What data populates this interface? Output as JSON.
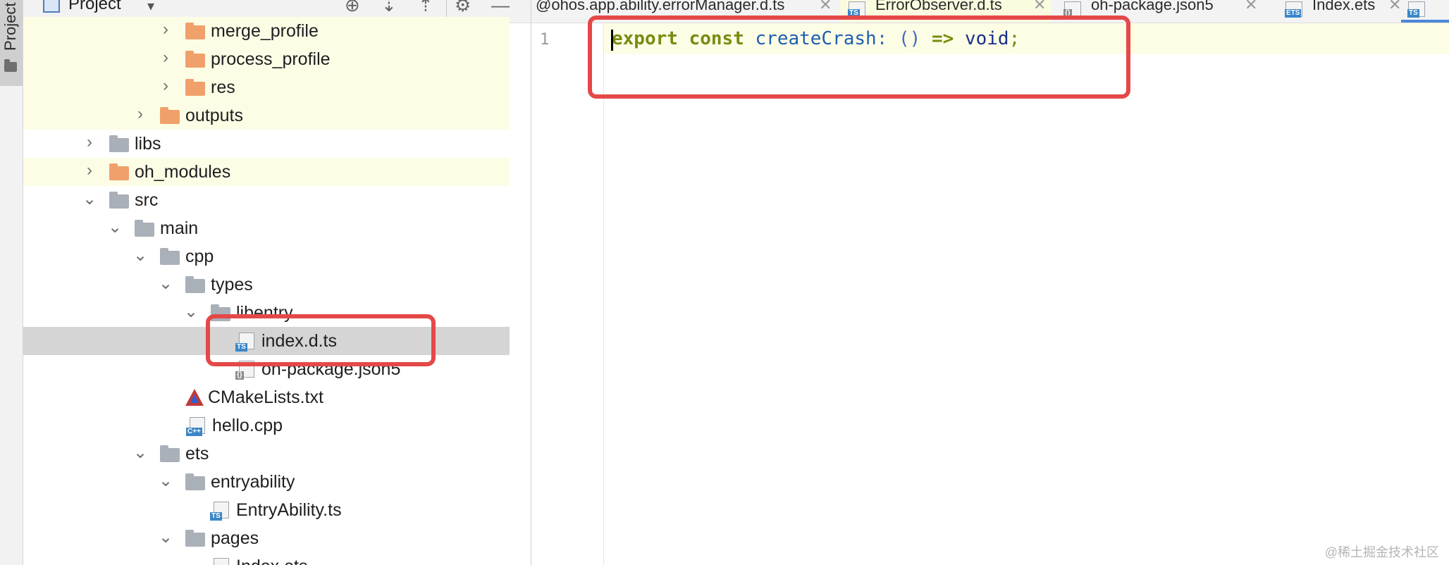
{
  "sidebar_strip": {
    "label": "Project"
  },
  "panel_header": {
    "title": "Project"
  },
  "tree": [
    {
      "label": "merge_profile",
      "kind": "folder-orange",
      "state": "collapsed"
    },
    {
      "label": "process_profile",
      "kind": "folder-orange",
      "state": "collapsed"
    },
    {
      "label": "res",
      "kind": "folder-orange",
      "state": "collapsed"
    },
    {
      "label": "outputs",
      "kind": "folder-orange",
      "state": "collapsed"
    },
    {
      "label": "libs",
      "kind": "folder-gray",
      "state": "collapsed"
    },
    {
      "label": "oh_modules",
      "kind": "folder-orange",
      "state": "collapsed"
    },
    {
      "label": "src",
      "kind": "folder-gray",
      "state": "expanded"
    },
    {
      "label": "main",
      "kind": "folder-gray",
      "state": "expanded"
    },
    {
      "label": "cpp",
      "kind": "folder-gray",
      "state": "expanded"
    },
    {
      "label": "types",
      "kind": "folder-gray",
      "state": "expanded"
    },
    {
      "label": "libentry",
      "kind": "folder-gray",
      "state": "expanded"
    },
    {
      "label": "index.d.ts",
      "kind": "file-ts",
      "state": "selected"
    },
    {
      "label": "oh-package.json5",
      "kind": "file-json"
    },
    {
      "label": "CMakeLists.txt",
      "kind": "file-cmake"
    },
    {
      "label": "hello.cpp",
      "kind": "file-cpp"
    },
    {
      "label": "ets",
      "kind": "folder-gray",
      "state": "expanded"
    },
    {
      "label": "entryability",
      "kind": "folder-gray",
      "state": "expanded"
    },
    {
      "label": "EntryAbility.ts",
      "kind": "file-ts"
    },
    {
      "label": "pages",
      "kind": "folder-gray",
      "state": "expanded"
    },
    {
      "label": "Index.ets",
      "kind": "file-ets"
    }
  ],
  "tabs": [
    {
      "label": "@ohos.app.ability.errorManager.d.ts",
      "icon": "ts-file-icon",
      "badge": "TS"
    },
    {
      "label": "ErrorObserver.d.ts",
      "icon": "ts-file-icon",
      "badge": "TS"
    },
    {
      "label": "oh-package.json5",
      "icon": "json-file-icon",
      "badge": "{}"
    },
    {
      "label": "Index.ets",
      "icon": "ets-file-icon",
      "badge": "ETS"
    },
    {
      "label": "",
      "icon": "ts-file-icon",
      "badge": "TS"
    }
  ],
  "editor": {
    "line_number": "1",
    "tokens": {
      "kw1": "export",
      "kw2": "const",
      "name": "createCrash",
      "colon": ":",
      "parens": "()",
      "arrow": "=>",
      "type": "void",
      "semi": ";"
    }
  },
  "watermark": "@稀土掘金技术社区",
  "colors": {
    "annotation": "#e54848",
    "highlight_row": "#fdfde6",
    "selected_row": "#d5d5d5",
    "tab_active_underline": "#4a88d8"
  }
}
